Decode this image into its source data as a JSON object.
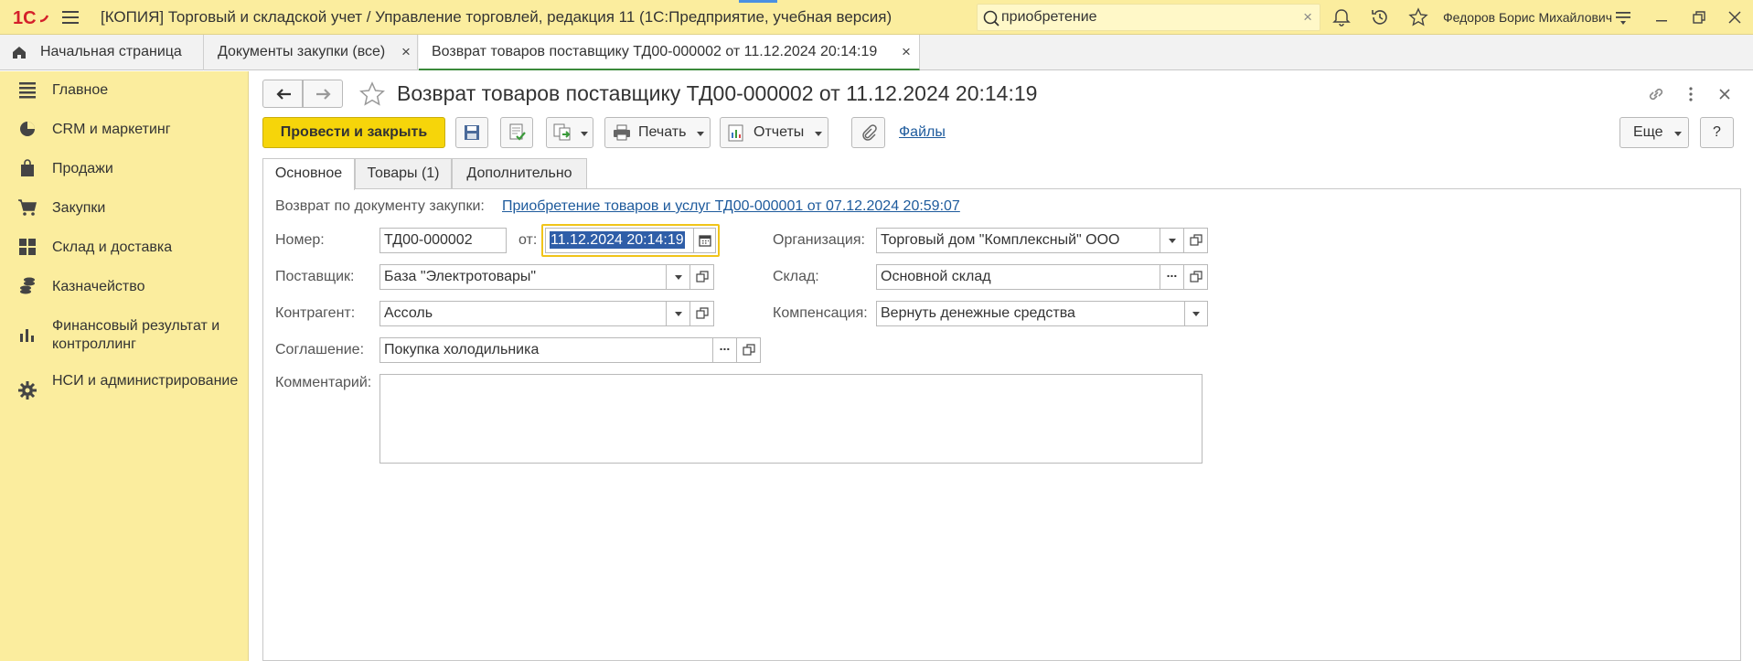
{
  "titlebar": {
    "app_title": "[КОПИЯ] Торговый и складской учет / Управление торговлей, редакция 11  (1С:Предприятие, учебная версия)",
    "search_value": "приобретение",
    "user_name": "Федоров Борис Михайлович"
  },
  "open_tabs": [
    {
      "label": "Начальная страница"
    },
    {
      "label": "Документы закупки (все)"
    },
    {
      "label": "Возврат товаров поставщику ТД00-000002 от 11.12.2024 20:14:19"
    }
  ],
  "sidebar": {
    "items": [
      {
        "label": "Главное"
      },
      {
        "label": "CRM и маркетинг"
      },
      {
        "label": "Продажи"
      },
      {
        "label": "Закупки"
      },
      {
        "label": "Склад и доставка"
      },
      {
        "label": "Казначейство"
      },
      {
        "label": "Финансовый результат и контроллинг"
      },
      {
        "label": "НСИ и администрирование"
      }
    ]
  },
  "document": {
    "title": "Возврат товаров поставщику ТД00-000002 от 11.12.2024 20:14:19"
  },
  "toolbar": {
    "post_close_label": "Провести и закрыть",
    "print_label": "Печать",
    "reports_label": "Отчеты",
    "files_label": "Файлы",
    "more_label": "Еще",
    "help_label": "?"
  },
  "form_tabs": [
    {
      "label": "Основное"
    },
    {
      "label": "Товары (1)"
    },
    {
      "label": "Дополнительно"
    }
  ],
  "form": {
    "return_by_label": "Возврат по документу закупки:",
    "return_by_link": "Приобретение товаров и услуг ТД00-000001 от 07.12.2024 20:59:07",
    "number_label": "Номер:",
    "number_value": "ТД00-000002",
    "from_label": "от:",
    "date_value": "11.12.2024 20:14:19",
    "supplier_label": "Поставщик:",
    "supplier_value": "База \"Электротовары\"",
    "counterparty_label": "Контрагент:",
    "counterparty_value": "Ассоль",
    "agreement_label": "Соглашение:",
    "agreement_value": "Покупка холодильника",
    "comment_label": "Комментарий:",
    "comment_value": "",
    "organization_label": "Организация:",
    "organization_value": "Торговый дом \"Комплексный\" ООО",
    "warehouse_label": "Склад:",
    "warehouse_value": "Основной склад",
    "compensation_label": "Компенсация:",
    "compensation_value": "Вернуть денежные средства"
  },
  "colors": {
    "titlebar_bg": "#fbed9e",
    "primary_button": "#f6d50a",
    "link": "#1d5a9c",
    "logo_red": "#d4202a",
    "date_focus_border": "#f0c419",
    "date_selection": "#2f5ea8"
  }
}
